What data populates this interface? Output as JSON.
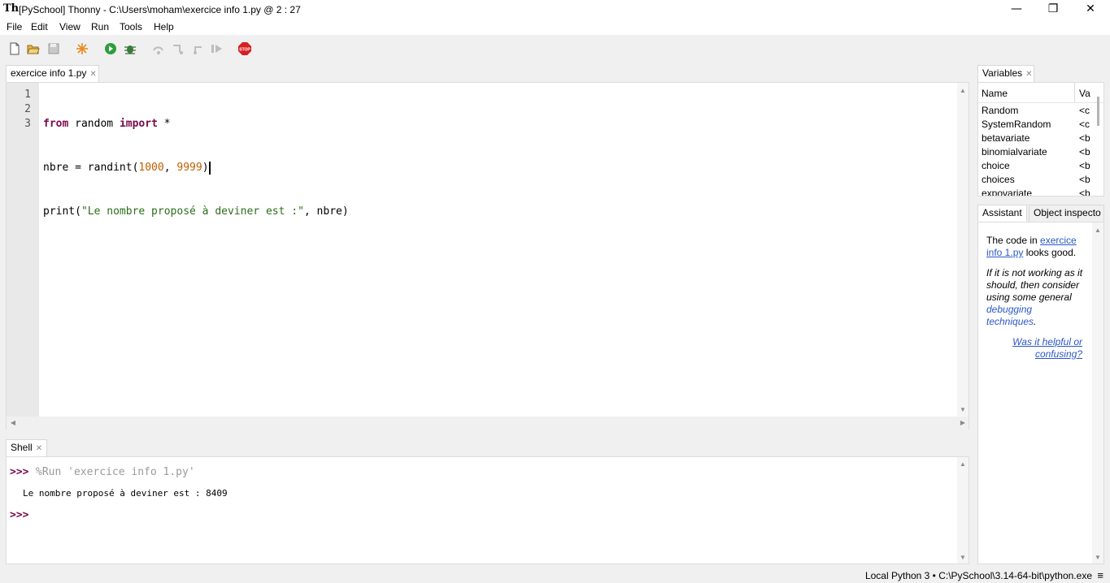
{
  "window": {
    "title": "[PySchool] Thonny  -  C:\\Users\\moham\\exercice info 1.py  @  2 : 27",
    "minimize": "—",
    "maximize": "❐",
    "close": "✕"
  },
  "menu": [
    "File",
    "Edit",
    "View",
    "Run",
    "Tools",
    "Help"
  ],
  "toolbar_icons": [
    "new-file-icon",
    "open-file-icon",
    "save-icon",
    "spark-icon",
    "run-icon",
    "debug-icon",
    "step-over-icon",
    "step-into-icon",
    "step-out-icon",
    "resume-icon",
    "stop-icon"
  ],
  "editor": {
    "tab": "exercice info 1.py",
    "line_numbers": [
      "1",
      "2",
      "3"
    ],
    "lines": [
      {
        "kw1": "from",
        "t1": " random ",
        "kw2": "import",
        "t2": " *"
      },
      {
        "t1": "nbre = randint(",
        "n1": "1000",
        "t2": ", ",
        "n2": "9999",
        "t3": ")"
      },
      {
        "t1": "print(",
        "s1": "\"Le nombre proposé à deviner est :\"",
        "t2": ", nbre)"
      }
    ]
  },
  "shell": {
    "tab": "Shell",
    "prompt": ">>>",
    "run_cmd": "%Run 'exercice info 1.py'",
    "output": "Le nombre proposé à deviner est : 8409"
  },
  "variables": {
    "tab": "Variables",
    "col_name": "Name",
    "col_value": "Va",
    "rows": [
      {
        "name": "Random",
        "value": "<c"
      },
      {
        "name": "SystemRandom",
        "value": "<c"
      },
      {
        "name": "betavariate",
        "value": "<b"
      },
      {
        "name": "binomialvariate",
        "value": "<b"
      },
      {
        "name": "choice",
        "value": "<b"
      },
      {
        "name": "choices",
        "value": "<b"
      },
      {
        "name": "expovariate",
        "value": "<b"
      }
    ]
  },
  "assistant": {
    "tab_assistant": "Assistant",
    "tab_inspector": "Object inspecto",
    "line1_prefix": "The code in ",
    "line1_link_a": "exercice",
    "line1_link_b": "info 1.py",
    "line1_suffix": " looks good.",
    "para2_l1": "If it is not working as it",
    "para2_l2": "should, then consider",
    "para2_l3": "using some general",
    "para2_link_a": "debugging",
    "para2_link_b": "techniques",
    "para2_end": ".",
    "feedback_a": "Was it helpful or",
    "feedback_b": "confusing?"
  },
  "status": {
    "interpreter": "Local Python 3  •  C:\\PySchool\\3.14-64-bit\\python.exe",
    "menu_glyph": "≡"
  }
}
